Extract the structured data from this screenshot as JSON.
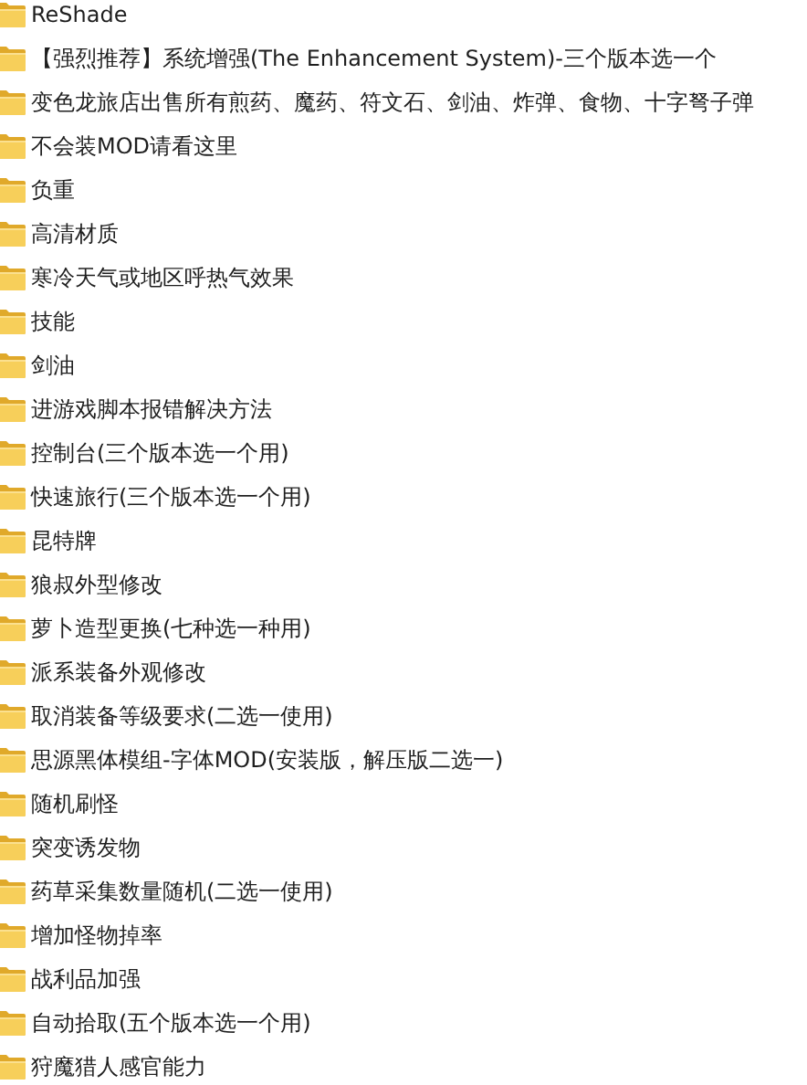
{
  "folders": [
    {
      "name": "ReShade"
    },
    {
      "name": "【强烈推荐】系统增强(The Enhancement System)-三个版本选一个"
    },
    {
      "name": "变色龙旅店出售所有煎药、魔药、符文石、剑油、炸弹、食物、十字弩子弹"
    },
    {
      "name": "不会装MOD请看这里"
    },
    {
      "name": "负重"
    },
    {
      "name": "高清材质"
    },
    {
      "name": "寒冷天气或地区呼热气效果"
    },
    {
      "name": "技能"
    },
    {
      "name": "剑油"
    },
    {
      "name": "进游戏脚本报错解决方法"
    },
    {
      "name": "控制台(三个版本选一个用)"
    },
    {
      "name": "快速旅行(三个版本选一个用)"
    },
    {
      "name": "昆特牌"
    },
    {
      "name": "狼叔外型修改"
    },
    {
      "name": "萝卜造型更换(七种选一种用)"
    },
    {
      "name": "派系装备外观修改"
    },
    {
      "name": "取消装备等级要求(二选一使用)"
    },
    {
      "name": "思源黑体模组-字体MOD(安装版，解压版二选一)"
    },
    {
      "name": "随机刷怪"
    },
    {
      "name": "突变诱发物"
    },
    {
      "name": "药草采集数量随机(二选一使用)"
    },
    {
      "name": "增加怪物掉率"
    },
    {
      "name": "战利品加强"
    },
    {
      "name": "自动拾取(五个版本选一个用)"
    },
    {
      "name": "狩魔猎人感官能力"
    }
  ]
}
